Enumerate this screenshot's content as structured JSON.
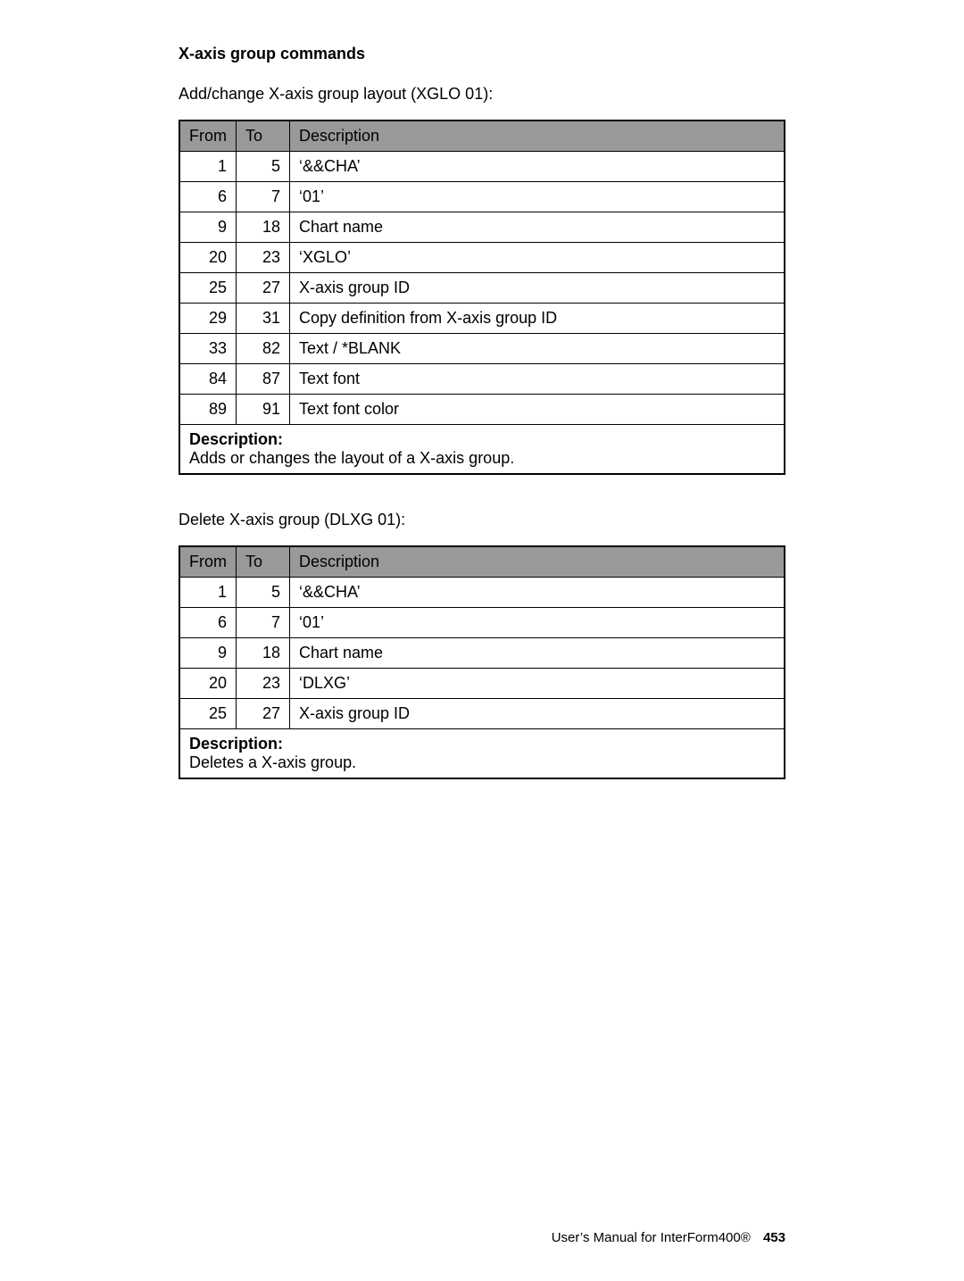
{
  "section_title": "X-axis group commands",
  "table1": {
    "caption": "Add/change X-axis group layout (XGLO 01):",
    "headers": {
      "from": "From",
      "to": "To",
      "desc": "Description"
    },
    "rows": [
      {
        "from": "1",
        "to": "5",
        "desc": "‘&&CHA’"
      },
      {
        "from": "6",
        "to": "7",
        "desc": "‘01’"
      },
      {
        "from": "9",
        "to": "18",
        "desc": "Chart name"
      },
      {
        "from": "20",
        "to": "23",
        "desc": "‘XGLO’"
      },
      {
        "from": "25",
        "to": "27",
        "desc": "X-axis group ID"
      },
      {
        "from": "29",
        "to": "31",
        "desc": "Copy definition from X-axis group ID"
      },
      {
        "from": "33",
        "to": "82",
        "desc": "Text / *BLANK"
      },
      {
        "from": "84",
        "to": "87",
        "desc": "Text font"
      },
      {
        "from": "89",
        "to": "91",
        "desc": "Text font color"
      }
    ],
    "description_label": "Description:",
    "description_text": "Adds or changes the layout of a X-axis group."
  },
  "table2": {
    "caption": "Delete X-axis group (DLXG 01):",
    "headers": {
      "from": "From",
      "to": "To",
      "desc": "Description"
    },
    "rows": [
      {
        "from": "1",
        "to": "5",
        "desc": "‘&&CHA’"
      },
      {
        "from": "6",
        "to": "7",
        "desc": "‘01’"
      },
      {
        "from": "9",
        "to": "18",
        "desc": "Chart name"
      },
      {
        "from": "20",
        "to": "23",
        "desc": "‘DLXG’"
      },
      {
        "from": "25",
        "to": "27",
        "desc": "X-axis group ID"
      }
    ],
    "description_label": "Description:",
    "description_text": "Deletes a X-axis group."
  },
  "footer": {
    "text": "User’s Manual for InterForm400®",
    "page": "453"
  }
}
